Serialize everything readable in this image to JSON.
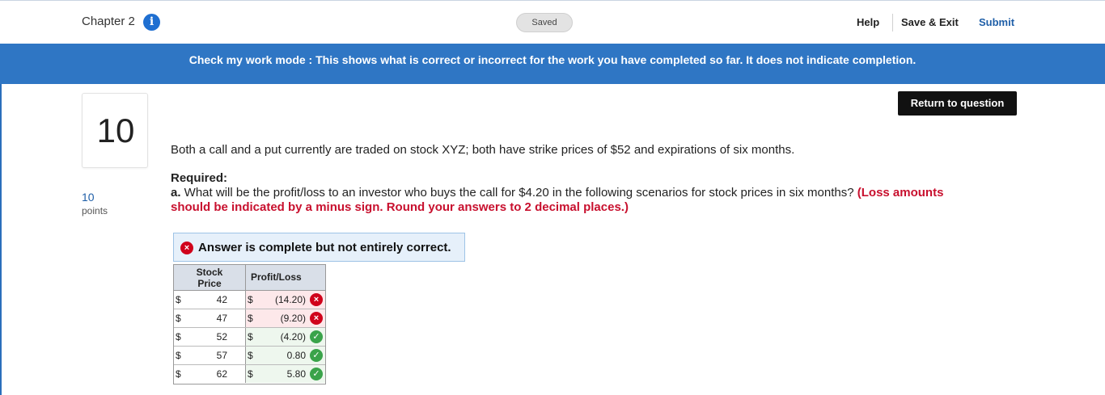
{
  "header": {
    "chapter": "Chapter 2",
    "info_icon": "i",
    "saved": "Saved",
    "help": "Help",
    "save_exit": "Save & Exit",
    "submit": "Submit"
  },
  "banner": {
    "text": "Check my work mode : This shows what is correct or incorrect for the work you have completed so far. It does not indicate completion."
  },
  "question": {
    "number": "10",
    "points_value": "10",
    "points_label": "points",
    "return_button": "Return to question",
    "text": "Both a call and a put currently are traded on stock XYZ; both have strike prices of $52 and expirations of six months.",
    "required_label": "Required:",
    "part_a_prefix": "a.",
    "part_a_text": " What will be the profit/loss to an investor who buys the call for $4.20 in the following scenarios for stock prices in six months? ",
    "part_a_instructions": "(Loss amounts should be indicated by a minus sign. Round your answers to 2 decimal places.)"
  },
  "answer": {
    "status_icon": "×",
    "status_text": "Answer is complete but not entirely correct."
  },
  "table": {
    "header_price": "Stock Price",
    "header_price_line1": "Stock",
    "header_price_line2": "Price",
    "header_pl": "Profit/Loss",
    "rows": [
      {
        "dollar1": "$",
        "price": "42",
        "dollar2": "$",
        "pl": "(14.20)",
        "status": "incorrect",
        "mark": "×"
      },
      {
        "dollar1": "$",
        "price": "47",
        "dollar2": "$",
        "pl": "(9.20)",
        "status": "incorrect",
        "mark": "×"
      },
      {
        "dollar1": "$",
        "price": "52",
        "dollar2": "$",
        "pl": "(4.20)",
        "status": "correct",
        "mark": "✓"
      },
      {
        "dollar1": "$",
        "price": "57",
        "dollar2": "$",
        "pl": "0.80",
        "status": "correct",
        "mark": "✓"
      },
      {
        "dollar1": "$",
        "price": "62",
        "dollar2": "$",
        "pl": "5.80",
        "status": "correct",
        "mark": "✓"
      }
    ]
  },
  "colors": {
    "banner": "#2f76c4",
    "link": "#1f5fa8",
    "error": "#d0021b",
    "success": "#3aa34a",
    "instruction_red": "#c8102e"
  }
}
